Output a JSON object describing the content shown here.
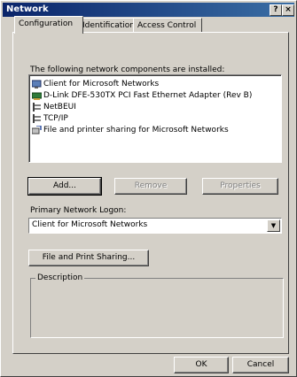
{
  "window": {
    "title": "Network",
    "help_glyph": "?",
    "close_glyph": "×"
  },
  "tabs": [
    {
      "label": "Configuration"
    },
    {
      "label": "Identification"
    },
    {
      "label": "Access Control"
    }
  ],
  "components": {
    "label": "The following network components are installed:",
    "items": [
      {
        "label": "Client for Microsoft Networks",
        "icon": "client-icon"
      },
      {
        "label": "D-Link DFE-530TX PCI Fast Ethernet Adapter (Rev B)",
        "icon": "network-adapter-icon"
      },
      {
        "label": "NetBEUI",
        "icon": "protocol-icon"
      },
      {
        "label": "TCP/IP",
        "icon": "protocol-icon"
      },
      {
        "label": "File and printer sharing for Microsoft Networks",
        "icon": "sharing-service-icon"
      }
    ]
  },
  "buttons": {
    "add": "Add...",
    "remove": "Remove",
    "properties": "Properties",
    "file_print_sharing": "File and Print Sharing...",
    "ok": "OK",
    "cancel": "Cancel"
  },
  "logon": {
    "label": "Primary Network Logon:",
    "value": "Client for Microsoft Networks",
    "arrow": "▼"
  },
  "description": {
    "title": "Description"
  }
}
